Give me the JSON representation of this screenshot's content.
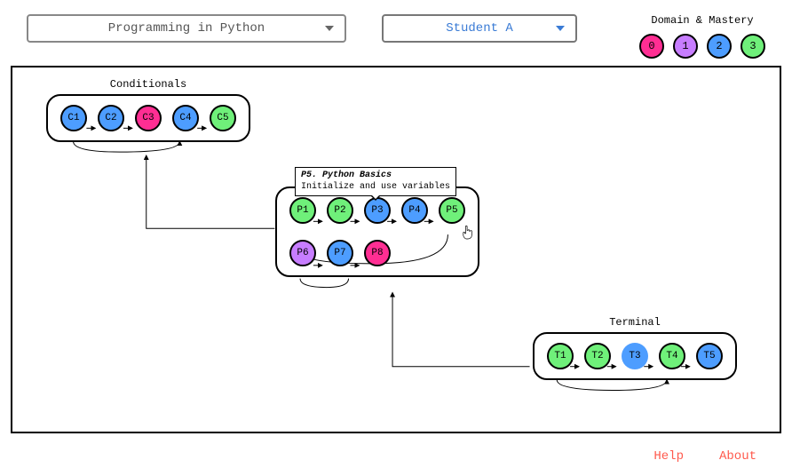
{
  "dropdowns": {
    "course": "Programming in Python",
    "student": "Student A"
  },
  "legend": {
    "title": "Domain & Mastery",
    "levels": [
      {
        "label": "0",
        "color": "pink"
      },
      {
        "label": "1",
        "color": "purple"
      },
      {
        "label": "2",
        "color": "blue"
      },
      {
        "label": "3",
        "color": "green"
      }
    ]
  },
  "groups": {
    "conditionals": {
      "title": "Conditionals",
      "nodes": [
        {
          "id": "C1",
          "color": "blue"
        },
        {
          "id": "C2",
          "color": "blue"
        },
        {
          "id": "C3",
          "color": "pink"
        },
        {
          "id": "C4",
          "color": "blue"
        },
        {
          "id": "C5",
          "color": "green"
        }
      ]
    },
    "python": {
      "title": "Python Basics",
      "row1": [
        {
          "id": "P1",
          "color": "green"
        },
        {
          "id": "P2",
          "color": "green"
        },
        {
          "id": "P3",
          "color": "blue"
        },
        {
          "id": "P4",
          "color": "blue"
        },
        {
          "id": "P5",
          "color": "green"
        }
      ],
      "row2": [
        {
          "id": "P6",
          "color": "purple"
        },
        {
          "id": "P7",
          "color": "blue"
        },
        {
          "id": "P8",
          "color": "pink"
        }
      ]
    },
    "terminal": {
      "title": "Terminal",
      "nodes": [
        {
          "id": "T1",
          "color": "green"
        },
        {
          "id": "T2",
          "color": "green"
        },
        {
          "id": "T3",
          "color": "blue",
          "noborder": true
        },
        {
          "id": "T4",
          "color": "green"
        },
        {
          "id": "T5",
          "color": "blue"
        }
      ]
    }
  },
  "tooltip": {
    "title": "P5. Python Basics",
    "desc": "Initialize and use variables"
  },
  "footer": {
    "help": "Help",
    "about": "About"
  },
  "colors": {
    "pink": "#ff2e93",
    "purple": "#c77dff",
    "blue": "#4d9dff",
    "green": "#6ff07a"
  }
}
